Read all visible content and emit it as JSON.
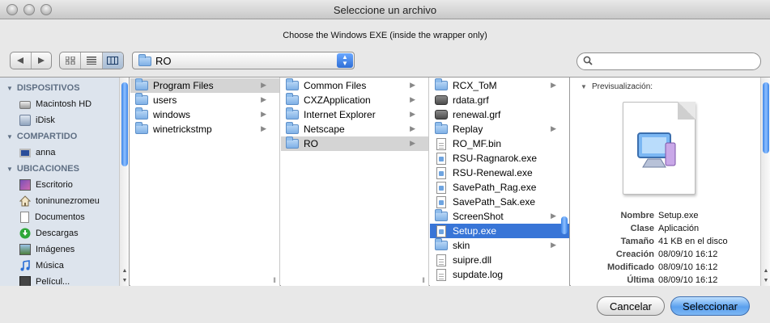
{
  "window": {
    "title": "Seleccione un archivo",
    "subtitle": "Choose the Windows EXE (inside the wrapper only)"
  },
  "toolbar": {
    "back_icon": "back-arrow-icon",
    "forward_icon": "forward-arrow-icon",
    "views": [
      "icon-view-icon",
      "list-view-icon",
      "column-view-icon"
    ],
    "active_view": "column-view",
    "location": "RO",
    "search_placeholder": ""
  },
  "sidebar": {
    "sections": [
      {
        "title": "DISPOSITIVOS",
        "items": [
          {
            "label": "Macintosh HD",
            "icon": "hard-drive-icon"
          },
          {
            "label": "iDisk",
            "icon": "idisk-icon"
          }
        ]
      },
      {
        "title": "COMPARTIDO",
        "items": [
          {
            "label": "anna",
            "icon": "monitor-icon"
          }
        ]
      },
      {
        "title": "UBICACIONES",
        "items": [
          {
            "label": "Escritorio",
            "icon": "desktop-icon"
          },
          {
            "label": "toninunezromeu",
            "icon": "home-icon"
          },
          {
            "label": "Documentos",
            "icon": "documents-icon"
          },
          {
            "label": "Descargas",
            "icon": "downloads-icon"
          },
          {
            "label": "Imágenes",
            "icon": "pictures-icon"
          },
          {
            "label": "Música",
            "icon": "music-icon"
          },
          {
            "label": "Películ...",
            "icon": "movies-icon"
          }
        ]
      }
    ]
  },
  "columns": [
    {
      "items": [
        {
          "label": "Program Files",
          "icon": "folder-icon",
          "has_children": true,
          "selected": "gray"
        },
        {
          "label": "users",
          "icon": "folder-icon",
          "has_children": true
        },
        {
          "label": "windows",
          "icon": "folder-icon",
          "has_children": true
        },
        {
          "label": "winetrickstmp",
          "icon": "folder-icon",
          "has_children": true
        }
      ]
    },
    {
      "items": [
        {
          "label": "Common Files",
          "icon": "folder-icon",
          "has_children": true
        },
        {
          "label": "CXZApplication",
          "icon": "folder-icon",
          "has_children": true
        },
        {
          "label": "Internet Explorer",
          "icon": "folder-icon",
          "has_children": true
        },
        {
          "label": "Netscape",
          "icon": "folder-icon",
          "has_children": true
        },
        {
          "label": "RO",
          "icon": "folder-icon",
          "has_children": true,
          "selected": "gray"
        }
      ]
    },
    {
      "items": [
        {
          "label": "RCX_ToM",
          "icon": "folder-icon",
          "has_children": true
        },
        {
          "label": "rdata.grf",
          "icon": "dark-folder-icon",
          "has_children": false
        },
        {
          "label": "renewal.grf",
          "icon": "dark-folder-icon",
          "has_children": false
        },
        {
          "label": "Replay",
          "icon": "folder-icon",
          "has_children": true
        },
        {
          "label": "RO_MF.bin",
          "icon": "document-icon",
          "has_children": false
        },
        {
          "label": "RSU-Ragnarok.exe",
          "icon": "executable-icon",
          "has_children": false
        },
        {
          "label": "RSU-Renewal.exe",
          "icon": "executable-icon",
          "has_children": false
        },
        {
          "label": "SavePath_Rag.exe",
          "icon": "executable-icon",
          "has_children": false
        },
        {
          "label": "SavePath_Sak.exe",
          "icon": "executable-icon",
          "has_children": false
        },
        {
          "label": "ScreenShot",
          "icon": "folder-icon",
          "has_children": true
        },
        {
          "label": "Setup.exe",
          "icon": "executable-icon",
          "has_children": false,
          "selected": "blue"
        },
        {
          "label": "skin",
          "icon": "folder-icon",
          "has_children": true
        },
        {
          "label": "suipre.dll",
          "icon": "document-icon",
          "has_children": false
        },
        {
          "label": "supdate.log",
          "icon": "document-icon",
          "has_children": false
        }
      ]
    }
  ],
  "preview": {
    "header": "Previsualización:",
    "icon": "setup-computer-icon",
    "info": [
      {
        "key": "Nombre",
        "value": "Setup.exe"
      },
      {
        "key": "Clase",
        "value": "Aplicación"
      },
      {
        "key": "Tamaño",
        "value": "41 KB en el disco"
      },
      {
        "key": "Creación",
        "value": "08/09/10 16:12"
      },
      {
        "key": "Modificado",
        "value": "08/09/10 16:12"
      },
      {
        "key": "Última",
        "value": "08/09/10 16:12"
      }
    ]
  },
  "buttons": {
    "cancel": "Cancelar",
    "ok": "Seleccionar"
  },
  "colors": {
    "selection_blue": "#3875d7",
    "selection_gray": "#d4d4d4",
    "sidebar_bg": "#dde4ed",
    "default_button": "#5aa0ee"
  }
}
